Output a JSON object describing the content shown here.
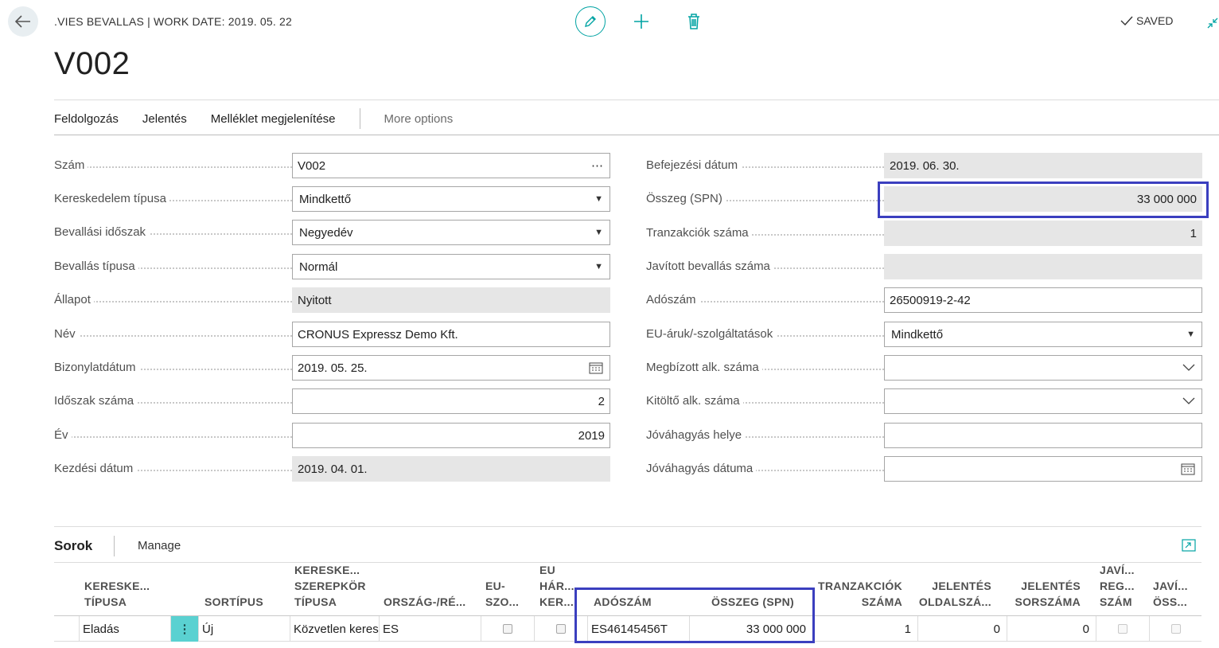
{
  "header": {
    "caption": ".VIES BEVALLAS | WORK DATE: 2019. 05. 22",
    "title": "V002",
    "saved_label": "SAVED"
  },
  "actions": {
    "items": [
      "Feldolgozás",
      "Jelentés",
      "Melléklet megjelenítése"
    ],
    "more": "More options"
  },
  "left_fields": [
    {
      "label": "Szám",
      "value": "V002",
      "kind": "assist"
    },
    {
      "label": "Kereskedelem típusa",
      "value": "Mindkettő",
      "kind": "select"
    },
    {
      "label": "Bevallási időszak",
      "value": "Negyedév",
      "kind": "select"
    },
    {
      "label": "Bevallás típusa",
      "value": "Normál",
      "kind": "select"
    },
    {
      "label": "Állapot",
      "value": "Nyitott",
      "kind": "readonly"
    },
    {
      "label": "Név",
      "value": "CRONUS Expressz Demo Kft.",
      "kind": "text"
    },
    {
      "label": "Bizonylatdátum",
      "value": "2019. 05. 25.",
      "kind": "date"
    },
    {
      "label": "Időszak száma",
      "value": "2",
      "kind": "number"
    },
    {
      "label": "Év",
      "value": "2019",
      "kind": "number"
    },
    {
      "label": "Kezdési dátum",
      "value": "2019. 04. 01.",
      "kind": "readonly"
    }
  ],
  "right_fields": [
    {
      "label": "Befejezési dátum",
      "value": "2019. 06. 30.",
      "kind": "readonly"
    },
    {
      "label": "Összeg (SPN)",
      "value": "33 000 000",
      "kind": "readonly-number"
    },
    {
      "label": "Tranzakciók száma",
      "value": "1",
      "kind": "readonly-number"
    },
    {
      "label": "Javított bevallás száma",
      "value": "",
      "kind": "readonly"
    },
    {
      "label": "Adószám",
      "value": "26500919-2-42",
      "kind": "text"
    },
    {
      "label": "EU-áruk/-szolgáltatások",
      "value": "Mindkettő",
      "kind": "select"
    },
    {
      "label": "Megbízott alk. száma",
      "value": "",
      "kind": "lookup"
    },
    {
      "label": "Kitöltő alk. száma",
      "value": "",
      "kind": "lookup"
    },
    {
      "label": "Jóváhagyás helye",
      "value": "",
      "kind": "text"
    },
    {
      "label": "Jóváhagyás dátuma",
      "value": "",
      "kind": "date"
    }
  ],
  "lines": {
    "title": "Sorok",
    "manage": "Manage",
    "columns": [
      {
        "l1": "",
        "l2": "KERESKE...",
        "l3": "TÍPUSA"
      },
      {
        "l1": "",
        "l2": "",
        "l3": "SORTÍPUS"
      },
      {
        "l1": "KERESKE...",
        "l2": "SZEREPKÖR",
        "l3": "TÍPUSA"
      },
      {
        "l1": "",
        "l2": "",
        "l3": "ORSZÁG-/RÉ..."
      },
      {
        "l1": "",
        "l2": "EU-",
        "l3": "SZO..."
      },
      {
        "l1": "EU",
        "l2": "HÁR...",
        "l3": "KER..."
      },
      {
        "l1": "",
        "l2": "",
        "l3": "ADÓSZÁM"
      },
      {
        "l1": "",
        "l2": "",
        "l3": "ÖSSZEG (SPN)"
      },
      {
        "l1": "",
        "l2": "TRANZAKCIÓK",
        "l3": "SZÁMA"
      },
      {
        "l1": "",
        "l2": "JELENTÉS",
        "l3": "OLDALSZÁ..."
      },
      {
        "l1": "",
        "l2": "JELENTÉS",
        "l3": "SORSZÁMA"
      },
      {
        "l1": "JAVÍ...",
        "l2": "REG...",
        "l3": "SZÁM"
      },
      {
        "l1": "",
        "l2": "JAVÍ...",
        "l3": "ÖSS..."
      }
    ],
    "rows": [
      {
        "trade_type": "Eladás",
        "line_type": "Új",
        "role_type": "Közvetlen keres",
        "country": "ES",
        "vat_no": "ES46145456T",
        "amount": "33 000 000",
        "tx_count": "1",
        "report_page": "0",
        "report_line": "0"
      }
    ]
  },
  "colors": {
    "accent": "#00a3a3",
    "highlight": "#3b3fbf",
    "readonly_bg": "#e6e6e6"
  }
}
